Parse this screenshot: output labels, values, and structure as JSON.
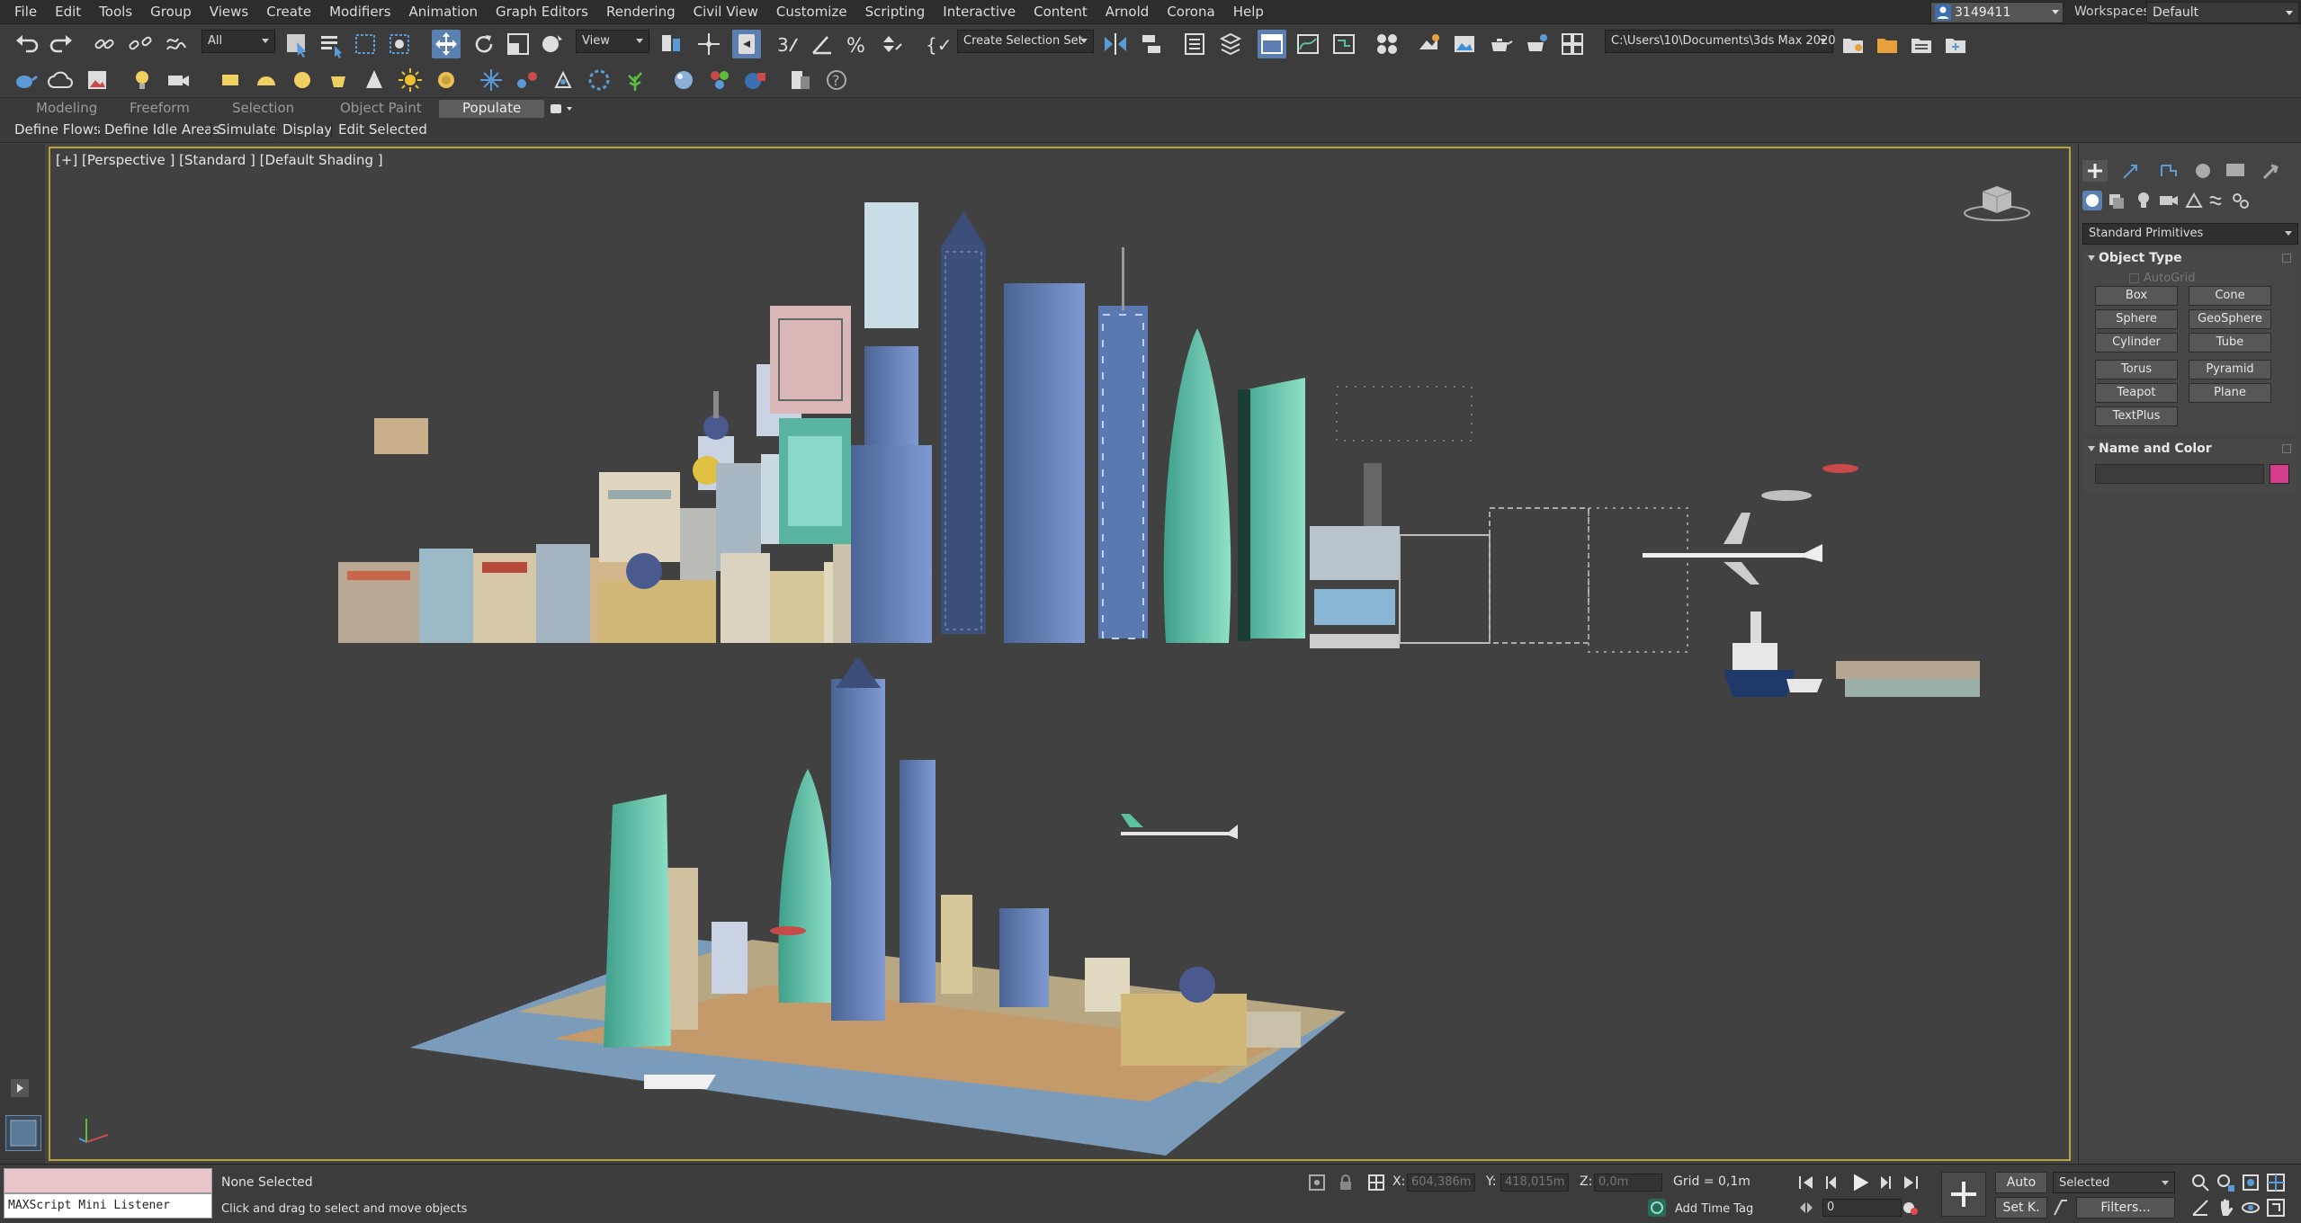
{
  "menu": [
    "File",
    "Edit",
    "Tools",
    "Group",
    "Views",
    "Create",
    "Modifiers",
    "Animation",
    "Graph Editors",
    "Rendering",
    "Civil View",
    "Customize",
    "Scripting",
    "Interactive",
    "Content",
    "Arnold",
    "Corona",
    "Help"
  ],
  "user": {
    "name": "3149411"
  },
  "workspace": {
    "label": "Workspaces:",
    "value": "Default"
  },
  "toolbar": {
    "filter_value": "All",
    "ref_coord_value": "View",
    "selection_set_value": "Create Selection Set",
    "project_path": "C:\\Users\\10\\Documents\\3ds Max 2020"
  },
  "ribbon": {
    "tabs": [
      "Modeling",
      "Freeform",
      "Selection",
      "Object Paint",
      "Populate"
    ],
    "active_tab": "Populate",
    "buttons": [
      "Define Flows",
      "Define Idle Areas",
      "Simulate",
      "Display",
      "Edit Selected"
    ]
  },
  "viewport": {
    "label": "[+] [Perspective ] [Standard ] [Default Shading ]"
  },
  "command_panel": {
    "category": "Standard Primitives",
    "object_type": {
      "title": "Object Type",
      "autogrid": "AutoGrid",
      "buttons": [
        "Box",
        "Cone",
        "Sphere",
        "GeoSphere",
        "Cylinder",
        "Tube",
        "Torus",
        "Pyramid",
        "Teapot",
        "Plane",
        "TextPlus"
      ]
    },
    "name_and_color": {
      "title": "Name and Color",
      "color": "#d43c8c"
    }
  },
  "status": {
    "listener": "MAXScript Mini Listener",
    "selection": "None Selected",
    "prompt": "Click and drag to select and move objects",
    "x_label": "X:",
    "x_value": "604,386m",
    "y_label": "Y:",
    "y_value": "418,015m",
    "z_label": "Z:",
    "z_value": "0,0m",
    "grid": "Grid = 0,1m",
    "add_time_tag": "Add Time Tag",
    "auto_key": "Auto",
    "set_key": "Set K.",
    "key_filter_value": "Selected",
    "filters": "Filters...",
    "frame": "0"
  },
  "colors": {
    "accent": "#5b7fb0",
    "viewport_border": "#b8a23a",
    "object_color": "#d43c8c"
  }
}
